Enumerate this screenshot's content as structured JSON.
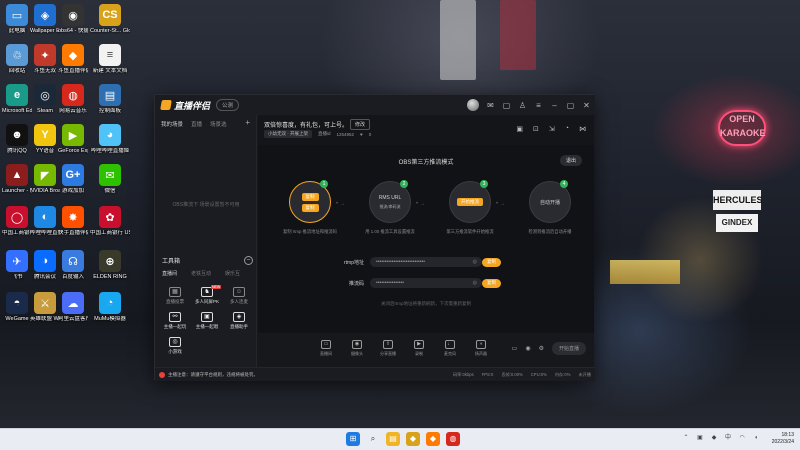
{
  "desktop": {
    "icons": [
      {
        "name": "computer",
        "label": "此电脑",
        "color": "#3b8bd9",
        "glyph": "▭"
      },
      {
        "name": "wallpaper-engine",
        "label": "Wallpaper Engine:...",
        "color": "#1f6fd1",
        "glyph": "◈"
      },
      {
        "name": "obs64",
        "label": "obs64 - 快捷方式",
        "color": "#333333",
        "glyph": "◉"
      },
      {
        "name": "csgo",
        "label": "Counter-St... Global Off...",
        "color": "#d9a21b",
        "glyph": "CS"
      },
      {
        "name": "recycle-bin",
        "label": "回收站",
        "color": "#5a9bd5",
        "glyph": "♲"
      },
      {
        "name": "shuiqian",
        "label": "斗鱼无双",
        "color": "#c0392b",
        "glyph": "✦"
      },
      {
        "name": "douyu-live",
        "label": "斗鱼直播伴侣",
        "color": "#ff7a00",
        "glyph": "◆"
      },
      {
        "name": "new-text",
        "label": "新建 文本文档",
        "color": "#f2f2f2",
        "glyph": "≡"
      },
      {
        "name": "edge",
        "label": "Microsoft Edge",
        "color": "#1a9b8a",
        "glyph": "e"
      },
      {
        "name": "steam",
        "label": "Steam",
        "color": "#1b2838",
        "glyph": "◎"
      },
      {
        "name": "netease-music",
        "label": "网易云音乐",
        "color": "#d6281c",
        "glyph": "◍"
      },
      {
        "name": "control-panel",
        "label": "控制面板",
        "color": "#2d6fb0",
        "glyph": "▤"
      },
      {
        "name": "qq",
        "label": "腾讯QQ",
        "color": "#111111",
        "glyph": "☻"
      },
      {
        "name": "yy",
        "label": "YY语音",
        "color": "#f1c40f",
        "glyph": "Y"
      },
      {
        "name": "geforce",
        "label": "GeForce Experience",
        "color": "#76b900",
        "glyph": "▶"
      },
      {
        "name": "bilibili-live",
        "label": "哔哩哔哩直播姬",
        "color": "#4fc3f7",
        "glyph": "◕"
      },
      {
        "name": "launcher",
        "label": "Launcher - 快捷方式",
        "color": "#8b1d1d",
        "glyph": "▲"
      },
      {
        "name": "nvidia-broadcast",
        "label": "NVIDIA Broadcast",
        "color": "#76b900",
        "glyph": "◤"
      },
      {
        "name": "gplus",
        "label": "游戏加加",
        "color": "#2d7be0",
        "glyph": "G+"
      },
      {
        "name": "wechat",
        "label": "微信",
        "color": "#2dc100",
        "glyph": "✉"
      },
      {
        "name": "icbc",
        "label": "中国工商银行网银助手",
        "color": "#c8102e",
        "glyph": "◯"
      },
      {
        "name": "bili-live2",
        "label": "哔哩哔哩直播姬",
        "color": "#1e88e5",
        "glyph": "◐"
      },
      {
        "name": "kuaishou",
        "label": "快手直播伴侣",
        "color": "#ff5000",
        "glyph": "✸"
      },
      {
        "name": "icbc-ukey",
        "label": "中国工商银行 USBKey 驱...",
        "color": "#c8102e",
        "glyph": "✿"
      },
      {
        "name": "feishu",
        "label": "飞书",
        "color": "#3370ff",
        "glyph": "✈"
      },
      {
        "name": "tencent-meeting",
        "label": "腾讯会议",
        "color": "#0a6bff",
        "glyph": "◑"
      },
      {
        "name": "baidu-input",
        "label": "百度输入",
        "color": "#3a7be0",
        "glyph": "☊"
      },
      {
        "name": "elden-ring",
        "label": "ELDEN RING",
        "color": "#3a3a2a",
        "glyph": "⊕"
      },
      {
        "name": "wegame",
        "label": "WeGame",
        "color": "#1a2a4a",
        "glyph": "◓"
      },
      {
        "name": "wegame-hero",
        "label": "英雄联盟 WeGame版",
        "color": "#c89b3c",
        "glyph": "⚔"
      },
      {
        "name": "ali-disk",
        "label": "阿里云盘客户端",
        "color": "#4a6cf7",
        "glyph": "☁"
      },
      {
        "name": "mumu",
        "label": "MuMu模拟器",
        "color": "#19a7f0",
        "glyph": "◔"
      }
    ]
  },
  "app": {
    "name": "直播伴侣",
    "version_label": "公测",
    "left_tabs": [
      "我的场景",
      "直播",
      "场景选"
    ],
    "left_empty_hint": "OBS推流下 场景设置暂不可用",
    "tools_title": "工具箱",
    "tools_subtabs": [
      "直播间",
      "老铁互动",
      "娱乐互"
    ],
    "tools": [
      {
        "icon": "poll-icon",
        "glyph": "▦",
        "label": "直播投票",
        "bright": false
      },
      {
        "icon": "pk-icon",
        "glyph": "♞",
        "label": "多人同屏PK",
        "bright": true,
        "badge": "NEW"
      },
      {
        "icon": "mic-group-icon",
        "glyph": "☺",
        "label": "多人连麦",
        "bright": false
      },
      {
        "icon": "link-icon",
        "glyph": "⚯",
        "label": "主播一起玩",
        "bright": true
      },
      {
        "icon": "fans-icon",
        "glyph": "▣",
        "label": "主播一起唱",
        "bright": true
      },
      {
        "icon": "assistant-icon",
        "glyph": "◈",
        "label": "直播助手",
        "bright": true
      },
      {
        "icon": "gamepad-icon",
        "glyph": "◎",
        "label": "小游戏",
        "bright": true
      }
    ],
    "room": {
      "title": "双倍惊喜度，有礼包，可上号。",
      "edit_label": "修改",
      "category": "小幼无双 · 开展上架",
      "id_label": "直播id",
      "id_value": "1254952",
      "likes": "0"
    },
    "obs_title": "OBS第三方推流模式",
    "exit_label": "退出",
    "steps": [
      {
        "num": "1",
        "lines": [
          "复制",
          "复制"
        ],
        "desc": "复制 rtmp 推流地址和推流码",
        "active": true
      },
      {
        "num": "2",
        "lines": [
          "RMS URL",
          "推流/串码流"
        ],
        "desc": "用 1.00 推流工具设置推流",
        "active": false
      },
      {
        "num": "3",
        "lines": [
          "开始推流"
        ],
        "desc": "第三方推流软件开始推流",
        "active": false
      },
      {
        "num": "4",
        "lines": [
          "自动开播"
        ],
        "desc": "检测到推流后自动开播",
        "active": false
      }
    ],
    "rtmp_label": "rtmp地址",
    "rtmp_value": "••••••••••••••••••••••••••••",
    "key_label": "推流码",
    "key_value": "••••••••••••••••",
    "copy_label": "复制",
    "hint": "关闭后rtmp地址将重新刷新，下次需重新复制",
    "bottom_tools": [
      {
        "icon": "screen-icon",
        "glyph": "▭",
        "label": "直播间"
      },
      {
        "icon": "camera-icon",
        "glyph": "◉",
        "label": "摄像头"
      },
      {
        "icon": "share-icon",
        "glyph": "⇪",
        "label": "分享直播"
      },
      {
        "icon": "video-icon",
        "glyph": "▶",
        "label": "录制"
      },
      {
        "icon": "mic-icon",
        "glyph": "♩",
        "label": "麦克风"
      },
      {
        "icon": "speaker-icon",
        "glyph": "◖",
        "label": "扬声器"
      }
    ],
    "start_label": "开始直播",
    "notice": "主播注意：请遵守平台规则，违规将被处罚。",
    "stats": [
      "码率:0kbps",
      "FPS:0",
      "丢帧:0.00%",
      "CPU:0%",
      "内存:0%",
      "未开播"
    ]
  },
  "taskbar": {
    "apps": [
      {
        "name": "windows",
        "glyph": "⊞",
        "color": "#1f7be0"
      },
      {
        "name": "search",
        "glyph": "⌕",
        "color": "#555555"
      },
      {
        "name": "file-explorer",
        "glyph": "▤",
        "color": "#f0b429"
      },
      {
        "name": "csgo-tb",
        "glyph": "◆",
        "color": "#d9a21b"
      },
      {
        "name": "douyu-tb",
        "glyph": "◆",
        "color": "#ff7a00"
      },
      {
        "name": "netease-tb",
        "glyph": "◍",
        "color": "#d6281c"
      }
    ],
    "time": "18:13",
    "date": "2022/3/24"
  }
}
